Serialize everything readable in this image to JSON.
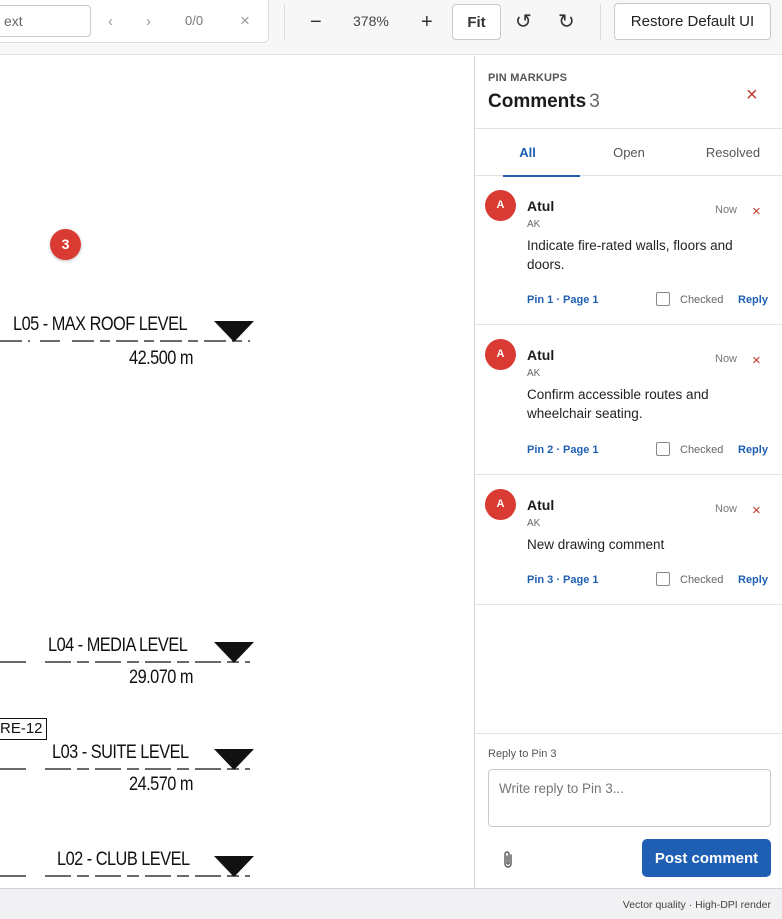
{
  "toolbar": {
    "search_value": "ext",
    "prev_glyph": "‹",
    "next_glyph": "›",
    "search_count": "0/0",
    "clear_glyph": "×",
    "zoom_out": "−",
    "zoom_level": "378%",
    "zoom_in": "+",
    "fit_label": "Fit",
    "rotate_ccw_glyph": "↺",
    "rotate_cw_glyph": "↻",
    "restore_label": "Restore Default UI"
  },
  "drawing": {
    "pin_marker": "3",
    "levels": [
      {
        "name": "L05 - MAX ROOF LEVEL",
        "elevation": "42.500 m"
      },
      {
        "name": "L04 - MEDIA LEVEL",
        "elevation": "29.070 m"
      },
      {
        "name": "L03 - SUITE LEVEL",
        "elevation": "24.570 m"
      },
      {
        "name": "L02 - CLUB LEVEL",
        "elevation": ""
      }
    ],
    "tag": "RE-12"
  },
  "panel": {
    "kicker": "PIN MARKUPS",
    "title": "Comments",
    "count": "3",
    "close_glyph": "×",
    "tabs": [
      {
        "label": "All",
        "active": true
      },
      {
        "label": "Open",
        "active": false
      },
      {
        "label": "Resolved",
        "active": false
      }
    ],
    "comments": [
      {
        "avatar": "A",
        "author": "Atul",
        "initials": "AK",
        "time": "Now",
        "delete_glyph": "×",
        "body": "Indicate fire-rated walls, floors and doors.",
        "pin_ref": "Pin 1 · Page 1",
        "checked_label": "Checked",
        "reply_label": "Reply"
      },
      {
        "avatar": "A",
        "author": "Atul",
        "initials": "AK",
        "time": "Now",
        "delete_glyph": "×",
        "body": "Confirm accessible routes and wheelchair seating.",
        "pin_ref": "Pin 2 · Page 1",
        "checked_label": "Checked",
        "reply_label": "Reply"
      },
      {
        "avatar": "A",
        "author": "Atul",
        "initials": "AK",
        "time": "Now",
        "delete_glyph": "×",
        "body": "New drawing comment",
        "pin_ref": "Pin 3 · Page 1",
        "checked_label": "Checked",
        "reply_label": "Reply"
      }
    ],
    "reply": {
      "label": "Reply to Pin 3",
      "placeholder": "Write reply to Pin 3...",
      "attach_icon": "paperclip-icon",
      "post_label": "Post comment"
    }
  },
  "footer": {
    "text": "Vector quality · High-DPI render"
  },
  "colors": {
    "accent": "#1f5fb3",
    "pin_red": "#d93a32",
    "danger": "#c0392b"
  }
}
